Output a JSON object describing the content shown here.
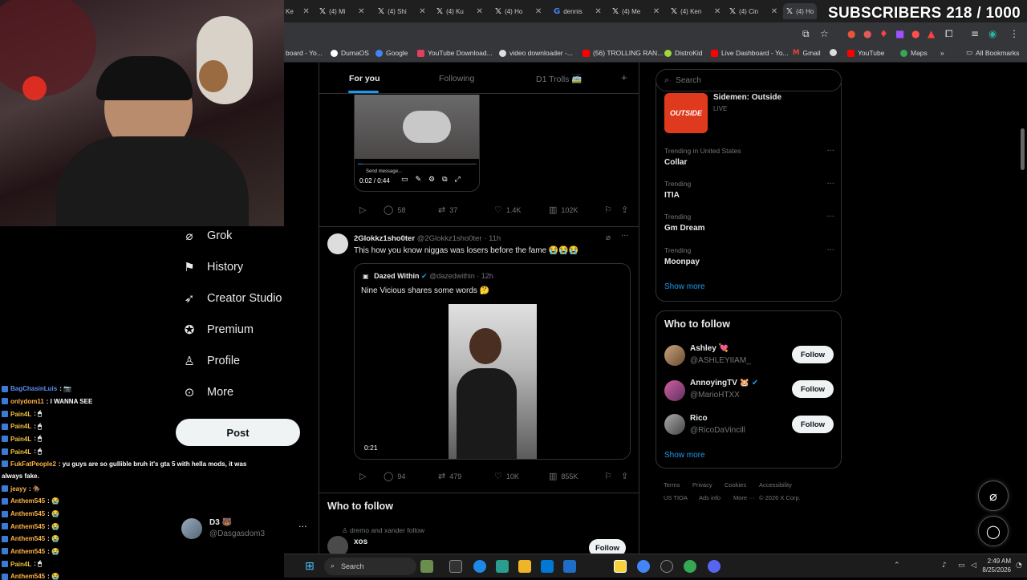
{
  "overlay": {
    "subscribers_text": "SUBSCRIBERS 218 / 1000"
  },
  "browser": {
    "tabs": [
      {
        "label": "Ke"
      },
      {
        "label": "(4) Mi"
      },
      {
        "label": "(4) Shi"
      },
      {
        "label": "(4) Ku"
      },
      {
        "label": "(4) Ho"
      },
      {
        "label": "dennis"
      },
      {
        "label": "(4) Me"
      },
      {
        "label": "(4) Ken"
      },
      {
        "label": "(4) Cin"
      },
      {
        "label": "(4) Ho"
      }
    ],
    "bookmarks": [
      {
        "label": "board - Yo...",
        "color": "#cc0000"
      },
      {
        "label": "DumaOS",
        "color": "#ffffff"
      },
      {
        "label": "Google",
        "color": "#ffffff"
      },
      {
        "label": "YouTube Download...",
        "color": "#e04060"
      },
      {
        "label": "video downloader -...",
        "color": "#ffffff"
      },
      {
        "label": "(56) TROLLING RAN...",
        "color": "#ff0000"
      },
      {
        "label": "DistroKid",
        "color": "#9fd63a"
      },
      {
        "label": "Live Dashboard - Yo...",
        "color": "#ff0000"
      },
      {
        "label": "Gmail",
        "color": "#ea4335"
      },
      {
        "label": "YouTube",
        "color": "#ff0000"
      },
      {
        "label": "Maps",
        "color": "#34a853"
      }
    ],
    "all_bookmarks": "All Bookmarks"
  },
  "nav": {
    "items": [
      {
        "label": "Grok",
        "icon": "grok-icon"
      },
      {
        "label": "History",
        "icon": "bookmark-icon"
      },
      {
        "label": "Creator Studio",
        "icon": "rocket-icon"
      },
      {
        "label": "Premium",
        "icon": "verified-icon"
      },
      {
        "label": "Profile",
        "icon": "person-icon"
      },
      {
        "label": "More",
        "icon": "more-circle-icon"
      }
    ],
    "post_label": "Post",
    "account": {
      "name": "D3 🐻",
      "handle": "@Dasgasdom3"
    }
  },
  "chat": [
    {
      "user": "BagChasinLuis",
      "msg": ": 📷",
      "color": "#5b8def"
    },
    {
      "user": "onlydom11",
      "msg": ": I WANNA SEE",
      "color": "#ffb347"
    },
    {
      "user": "Pain4L",
      "msg": ": 🖱",
      "color": "#f0c040"
    },
    {
      "user": "Pain4L",
      "msg": ": 🖱",
      "color": "#f0c040"
    },
    {
      "user": "Pain4L",
      "msg": ": 🖱",
      "color": "#f0c040"
    },
    {
      "user": "Pain4L",
      "msg": ": 🖱",
      "color": "#f0c040"
    },
    {
      "user": "FukFatPeople2",
      "msg": ": yu guys are so gullible bruh it's gta 5 with hella mods, it was",
      "color": "#ffb347"
    },
    {
      "user": "",
      "msg": "always fake.",
      "color": "#ffffff"
    },
    {
      "user": "jeayy",
      "msg": ": 🏇",
      "color": "#ffb347"
    },
    {
      "user": "Anthem545",
      "msg": ": 😭",
      "color": "#ffb347"
    },
    {
      "user": "Anthem545",
      "msg": ": 😭",
      "color": "#ffb347"
    },
    {
      "user": "Anthem545",
      "msg": ": 😭",
      "color": "#ffb347"
    },
    {
      "user": "Anthem545",
      "msg": ": 😭",
      "color": "#ffb347"
    },
    {
      "user": "Anthem545",
      "msg": ": 😭",
      "color": "#ffb347"
    },
    {
      "user": "Pain4L",
      "msg": ": 🖱",
      "color": "#f0c040"
    },
    {
      "user": "Anthem545",
      "msg": ": 😭",
      "color": "#ffb347"
    }
  ],
  "timeline": {
    "tabs": [
      "For you",
      "Following",
      "D1 Trolls 🚎"
    ],
    "tweet1": {
      "video_time": "0:02 / 0:44",
      "send_message": "Send message...",
      "stats": {
        "replies": "58",
        "reposts": "37",
        "likes": "1.4K",
        "views": "102K"
      }
    },
    "tweet2": {
      "name": "2Glokkz1sho0ter",
      "handle": "@2Glokkz1sho0ter",
      "time": "· 11h",
      "text": "This how you know niggas was losers before the fame 😭😭😭",
      "quote": {
        "name": "Dazed Within",
        "handle": "@dazedwithin",
        "time": "· 12h",
        "text": "Nine Vicious shares some words 🤔",
        "video_time": "0:21"
      },
      "stats": {
        "replies": "94",
        "reposts": "479",
        "likes": "10K",
        "views": "855K"
      }
    },
    "who_to_follow": {
      "title": "Who to follow",
      "social": "dremo and xander follow",
      "name": "xos",
      "button": "Follow"
    }
  },
  "sidebar": {
    "search_placeholder": "Search",
    "live": {
      "title": "Sidemen: Outside",
      "status": "LIVE",
      "thumb_text": "OUTSIDE"
    },
    "trends": [
      {
        "context": "Trending in United States",
        "name": "Collar"
      },
      {
        "context": "Trending",
        "name": "ITIA"
      },
      {
        "context": "Trending",
        "name": "Gm Dream"
      },
      {
        "context": "Trending",
        "name": "Moonpay"
      }
    ],
    "show_more": "Show more",
    "who_to_follow": {
      "title": "Who to follow",
      "users": [
        {
          "name": "Ashley 💘",
          "handle": "@ASHLEYIIAM_",
          "button": "Follow"
        },
        {
          "name": "AnnoyingTV 🐹",
          "handle": "@MarioHTXX",
          "button": "Follow"
        },
        {
          "name": "Rico",
          "handle": "@RicoDaVincill",
          "button": "Follow"
        }
      ],
      "show_more": "Show more"
    },
    "footer": [
      "Terms",
      "Privacy",
      "Cookies",
      "Accessibility",
      "US TIOA",
      "Ads info",
      "More ···",
      "© 2026 X Corp."
    ]
  },
  "taskbar": {
    "search": "Search",
    "time": "2:49 AM",
    "date": "8/25/2026"
  }
}
